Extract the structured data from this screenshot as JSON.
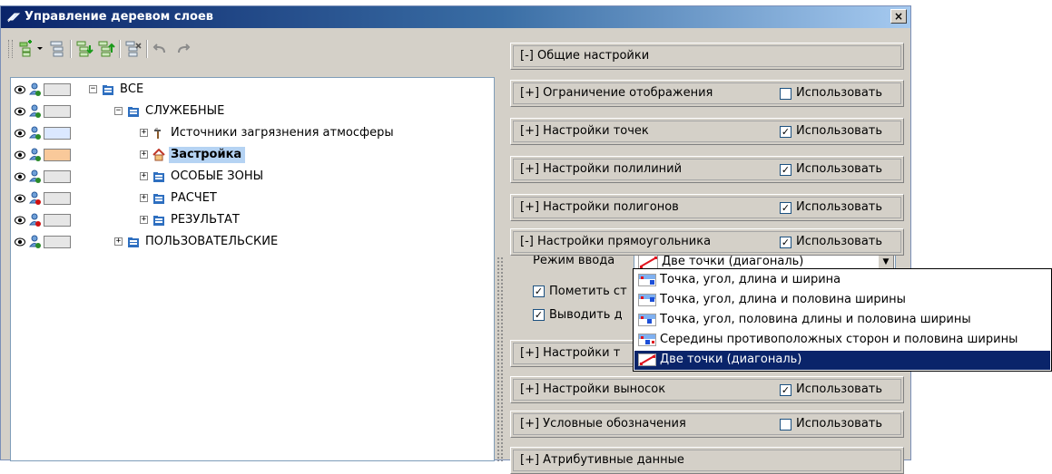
{
  "window": {
    "title": "Управление деревом слоев",
    "close_label": "×"
  },
  "toolbar": {
    "buttons": [
      "add-layer",
      "layer-props",
      "move-down",
      "move-up",
      "delete-layer",
      "undo",
      "redo"
    ]
  },
  "tree": {
    "rows": [
      {
        "label": "ВСЕ",
        "expander": "−",
        "icon": "folder-icon",
        "swatch": "#e6e6e6",
        "bold": false,
        "selected": false
      },
      {
        "label": "СЛУЖЕБНЫЕ",
        "expander": "−",
        "icon": "folder-icon",
        "swatch": "#e6e6e6",
        "bold": false,
        "selected": false
      },
      {
        "label": "Источники загрязнения атмосферы",
        "expander": "+",
        "icon": "factory-icon",
        "swatch": "#dbe8ff",
        "bold": false,
        "selected": false
      },
      {
        "label": "Застройка",
        "expander": "+",
        "icon": "house-icon",
        "swatch": "#f9c99a",
        "bold": true,
        "selected": true
      },
      {
        "label": "ОСОБЫЕ ЗОНЫ",
        "expander": "+",
        "icon": "folder-icon",
        "swatch": "#e6e6e6",
        "bold": false,
        "selected": false
      },
      {
        "label": "РАСЧЕТ",
        "expander": "+",
        "icon": "folder-icon",
        "swatch": "#e6e6e6",
        "bold": false,
        "selected": false
      },
      {
        "label": "РЕЗУЛЬТАТ",
        "expander": "+",
        "icon": "folder-icon",
        "swatch": "#e6e6e6",
        "bold": false,
        "selected": false
      },
      {
        "label": "ПОЛЬЗОВАТЕЛЬСКИЕ",
        "expander": "+",
        "icon": "folder-icon",
        "swatch": "#e6e6e6",
        "bold": false,
        "selected": false
      }
    ]
  },
  "settings": {
    "sections": [
      {
        "title": "[-] Общие настройки",
        "has_check": false,
        "checked": false,
        "check_label": ""
      },
      {
        "title": "[+] Ограничение отображения",
        "has_check": true,
        "checked": false,
        "check_label": "Использовать"
      },
      {
        "title": "[+] Настройки точек",
        "has_check": true,
        "checked": true,
        "check_label": "Использовать"
      },
      {
        "title": "[+] Настройки полилиний",
        "has_check": true,
        "checked": true,
        "check_label": "Использовать"
      },
      {
        "title": "[+] Настройки полигонов",
        "has_check": true,
        "checked": true,
        "check_label": "Использовать"
      },
      {
        "title": "[-] Настройки прямоугольника",
        "has_check": true,
        "checked": true,
        "check_label": "Использовать"
      },
      {
        "title": "[+] Настройки т",
        "has_check": false,
        "checked": false,
        "check_label": ""
      },
      {
        "title": "[+] Настройки выносок",
        "has_check": true,
        "checked": true,
        "check_label": "Использовать"
      },
      {
        "title": "[+] Условные обозначения",
        "has_check": true,
        "checked": false,
        "check_label": "Использовать"
      },
      {
        "title": "[+] Атрибутивные данные",
        "has_check": false,
        "checked": false,
        "check_label": ""
      }
    ],
    "rect": {
      "mode_label": "Режим ввода",
      "mode_value": "Две точки (диагональ)",
      "mark_label": "Пометить ст",
      "mark_checked": true,
      "output_label": "Выводить д",
      "output_checked": true
    }
  },
  "dropdown": {
    "options": [
      {
        "label": "Точка, угол, длина и ширина",
        "active": false,
        "icon": "point-angle-length-width-icon"
      },
      {
        "label": "Точка, угол, длина и половина ширины",
        "active": false,
        "icon": "point-angle-length-halfwidth-icon"
      },
      {
        "label": "Точка, угол, половина длины и половина ширины",
        "active": false,
        "icon": "point-angle-halflength-halfwidth-icon"
      },
      {
        "label": "Середины противоположных сторон и половина ширины",
        "active": false,
        "icon": "midpoints-halfwidth-icon"
      },
      {
        "label": "Две точки (диагональ)",
        "active": true,
        "icon": "two-points-diagonal-icon"
      }
    ]
  }
}
